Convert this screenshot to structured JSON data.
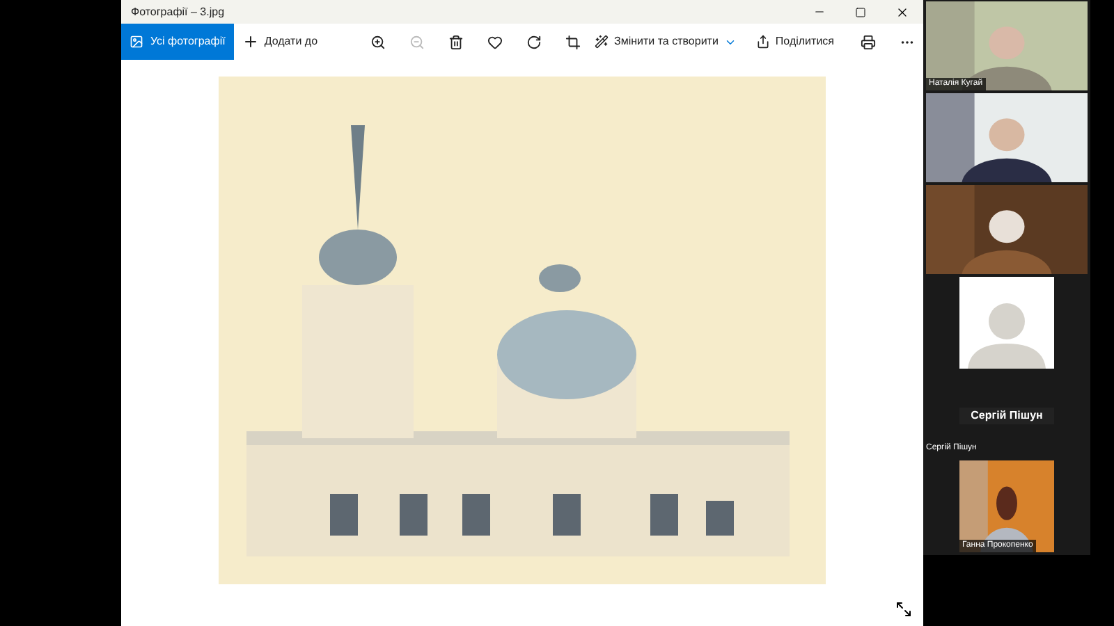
{
  "window": {
    "title": "Фотографії – 3.jpg"
  },
  "toolbar": {
    "nav": {
      "label": "Усі фотографії",
      "selected": true
    },
    "add": {
      "label": "Додати до"
    },
    "tools": [
      {
        "kind": "zoom-in",
        "disabled": false
      },
      {
        "kind": "zoom-out",
        "disabled": true
      },
      {
        "kind": "delete",
        "disabled": false
      },
      {
        "kind": "favorite",
        "disabled": false
      },
      {
        "kind": "rotate",
        "disabled": false
      },
      {
        "kind": "crop",
        "disabled": false
      }
    ],
    "edit": {
      "label": "Змінити та створити"
    },
    "share": {
      "label": "Поділитися"
    }
  },
  "participants": [
    {
      "kind": "video",
      "label": "Наталія Кугай"
    },
    {
      "kind": "video"
    },
    {
      "kind": "video"
    },
    {
      "kind": "avatar",
      "name": "Сергій Пішун",
      "label": "Сергій Пішун"
    },
    {
      "kind": "video",
      "label": "Ганна Прокопенко"
    }
  ]
}
